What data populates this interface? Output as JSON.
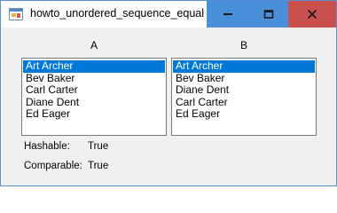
{
  "window": {
    "title": "howto_unordered_sequence_equal"
  },
  "icons": {
    "app": "app-window-icon",
    "minimize": "minimize-icon",
    "maximize": "maximize-icon",
    "close": "close-icon"
  },
  "colors": {
    "caption_button": "#4a8fd9",
    "close_button": "#c9504b",
    "selection": "#0078d7"
  },
  "lists": {
    "a": {
      "label": "A",
      "selected_index": 0,
      "items": [
        "Art Archer",
        "Bev Baker",
        "Carl Carter",
        "Diane Dent",
        "Ed Eager"
      ]
    },
    "b": {
      "label": "B",
      "selected_index": 0,
      "items": [
        "Art Archer",
        "Bev Baker",
        "Diane Dent",
        "Carl Carter",
        "Ed Eager"
      ]
    }
  },
  "results": {
    "hashable_label": "Hashable:",
    "hashable_value": "True",
    "comparable_label": "Comparable:",
    "comparable_value": "True"
  }
}
